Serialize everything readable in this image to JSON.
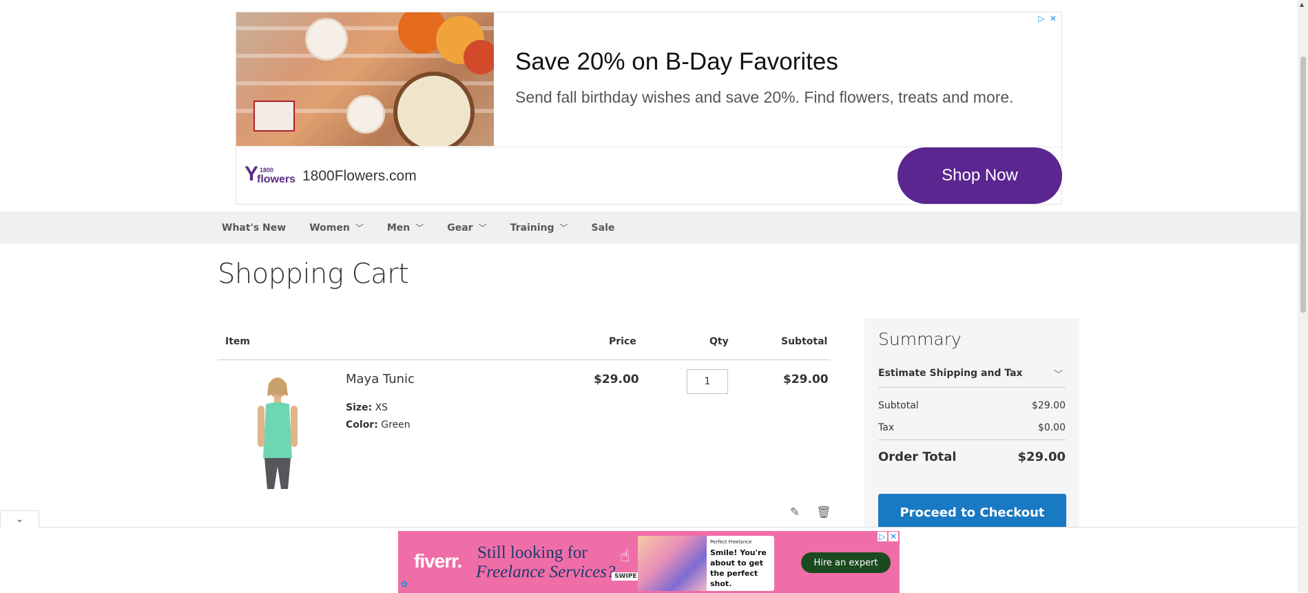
{
  "top_ad": {
    "headline": "Save 20% on B-Day Favorites",
    "description": "Send fall birthday wishes and save 20%. Find flowers, treats and more.",
    "logo_top": "1800",
    "logo_word": "flowers",
    "brand_name": "1800Flowers.com",
    "cta_label": "Shop Now",
    "ad_choices_icon": "ad-choices-icon",
    "close_icon": "close-icon",
    "cta_color": "#5b2690"
  },
  "nav": {
    "items": [
      {
        "label": "What's New",
        "has_dropdown": false
      },
      {
        "label": "Women",
        "has_dropdown": true
      },
      {
        "label": "Men",
        "has_dropdown": true
      },
      {
        "label": "Gear",
        "has_dropdown": true
      },
      {
        "label": "Training",
        "has_dropdown": true
      },
      {
        "label": "Sale",
        "has_dropdown": false
      }
    ]
  },
  "page": {
    "title": "Shopping Cart"
  },
  "cart": {
    "headers": {
      "item": "Item",
      "price": "Price",
      "qty": "Qty",
      "subtotal": "Subtotal"
    },
    "items": [
      {
        "name": "Maya Tunic",
        "options": [
          {
            "label": "Size:",
            "value": "XS"
          },
          {
            "label": "Color:",
            "value": "Green"
          }
        ],
        "price": "$29.00",
        "qty": "1",
        "subtotal": "$29.00",
        "edit_icon": "pencil-icon",
        "delete_icon": "trash-icon"
      }
    ]
  },
  "summary": {
    "title": "Summary",
    "estimate_label": "Estimate Shipping and Tax",
    "subtotal_label": "Subtotal",
    "subtotal_value": "$29.00",
    "tax_label": "Tax",
    "tax_value": "$0.00",
    "order_total_label": "Order Total",
    "order_total_value": "$29.00",
    "checkout_label": "Proceed to Checkout",
    "checkout_color": "#1979c3"
  },
  "bottom_ad": {
    "logo": "fiverr.",
    "line1": "Still looking for",
    "line2": "Freelance Services?",
    "swipe": "SWIPE",
    "card_kicker": "Perfect Freelance",
    "card_text": "Smile! You're about to get the perfect shot.",
    "cta_label": "Hire an expert",
    "collapse_icon": "chevron-down-icon"
  }
}
